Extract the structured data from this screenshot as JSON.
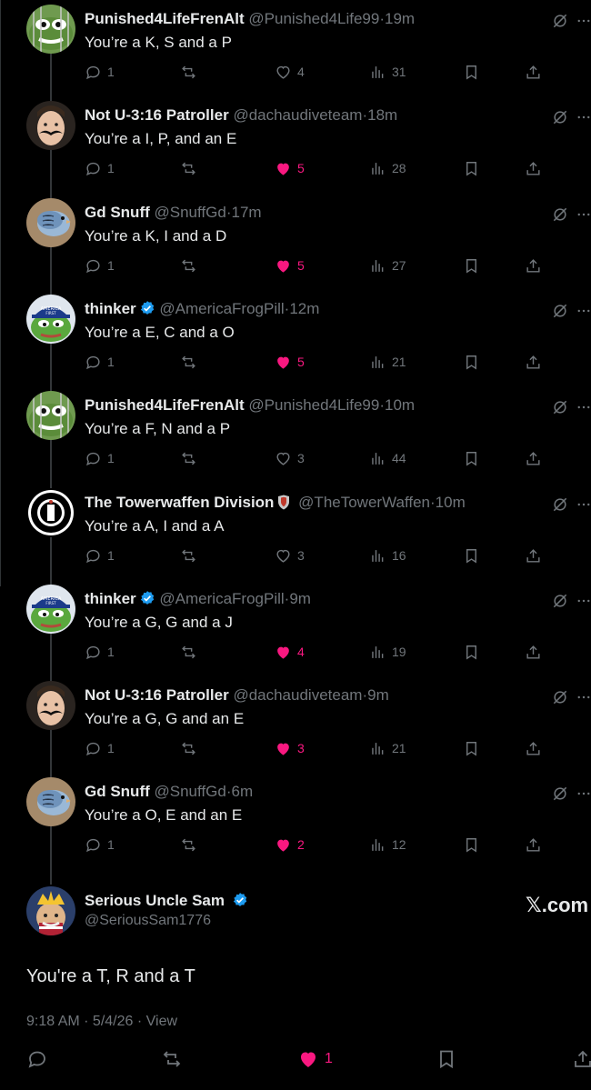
{
  "tweets": [
    {
      "name": "Punished4LifeFrenAlt",
      "handle": "@Punished4Life99",
      "dot": "·",
      "time": "19m",
      "text": "You’re a K, S and a P",
      "replies": "1",
      "likes": "4",
      "liked": false,
      "views": "31",
      "verified": false,
      "avatar": "frog-cage"
    },
    {
      "name": "Not U-3:16 Patroller",
      "handle": "@dachaudiveteam",
      "dot": "·",
      "time": "18m",
      "text": "You’re a I, P, and an E",
      "replies": "1",
      "likes": "5",
      "liked": true,
      "views": "28",
      "verified": false,
      "avatar": "mustache"
    },
    {
      "name": "Gd Snuff",
      "handle": "@SnuffGd",
      "dot": "·",
      "time": "17m",
      "text": "You’re a K, I and a D",
      "replies": "1",
      "likes": "5",
      "liked": true,
      "views": "27",
      "verified": false,
      "avatar": "bird"
    },
    {
      "name": "thinker",
      "handle": "@AmericaFrogPill",
      "dot": "·",
      "time": "12m",
      "text": "You’re a E, C and a O",
      "replies": "1",
      "likes": "5",
      "liked": true,
      "views": "21",
      "verified": true,
      "avatar": "frog-hat"
    },
    {
      "name": "Punished4LifeFrenAlt",
      "handle": "@Punished4Life99",
      "dot": "·",
      "time": "10m",
      "text": "You’re a F, N and a P",
      "replies": "1",
      "likes": "3",
      "liked": false,
      "views": "44",
      "verified": false,
      "avatar": "frog-cage"
    },
    {
      "name": "The Towerwaffen Division",
      "handle": "@TheTowerWaffen",
      "dot": "·",
      "time": "10m",
      "text": "You’re a A, I and a A",
      "replies": "1",
      "likes": "3",
      "liked": false,
      "views": "16",
      "verified": false,
      "shield": true,
      "avatar": "tower-seal"
    },
    {
      "name": "thinker",
      "handle": "@AmericaFrogPill",
      "dot": "·",
      "time": "9m",
      "text": "You’re a G, G and a J",
      "replies": "1",
      "likes": "4",
      "liked": true,
      "views": "19",
      "verified": true,
      "avatar": "frog-hat"
    },
    {
      "name": "Not U-3:16 Patroller",
      "handle": "@dachaudiveteam",
      "dot": "·",
      "time": "9m",
      "text": "You’re a G, G and an E",
      "replies": "1",
      "likes": "3",
      "liked": true,
      "views": "21",
      "verified": false,
      "avatar": "mustache"
    },
    {
      "name": "Gd Snuff",
      "handle": "@SnuffGd",
      "dot": "·",
      "time": "6m",
      "text": "You’re a O, E and an E",
      "replies": "1",
      "likes": "2",
      "liked": true,
      "views": "12",
      "verified": false,
      "avatar": "bird"
    }
  ],
  "main_tweet": {
    "name": "Serious Uncle Sam",
    "handle": "@SeriousSam1776",
    "logo_text": "𝕏.com",
    "text": "You're a T, R and a T",
    "meta": "9:18 AM · 5/4/26 · View",
    "likes": "1",
    "liked": true
  },
  "colors": {
    "like": "#f91880",
    "muted": "#71767b",
    "text": "#e7e9ea",
    "verified": "#1d9bf0",
    "background": "#000000"
  }
}
